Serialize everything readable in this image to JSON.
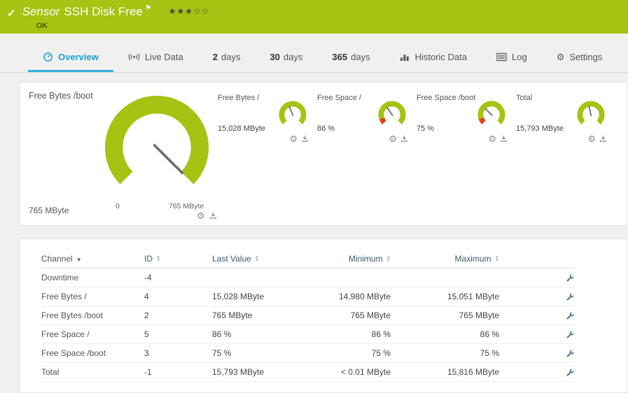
{
  "colors": {
    "brand_green": "#a5c312",
    "threshold_red": "#e0440f",
    "tab_blue": "#1d9ed3"
  },
  "header": {
    "title_prefix": "Sensor",
    "title": "SSH Disk Free",
    "status": "OK",
    "stars_filled": "★★★",
    "stars_empty": "☆☆"
  },
  "tabs": [
    {
      "label": "Overview"
    },
    {
      "label": "Live Data"
    },
    {
      "prefix": "2",
      "label": "days"
    },
    {
      "prefix": "30",
      "label": "days"
    },
    {
      "prefix": "365",
      "label": "days"
    },
    {
      "label": "Historic Data"
    },
    {
      "label": "Log"
    },
    {
      "label": "Settings"
    }
  ],
  "gauge_panel": {
    "primary": {
      "label": "Free Bytes /boot",
      "value": "765 MByte",
      "scale_min": "0",
      "scale_max": "765 MByte"
    },
    "minis": [
      {
        "label": "Free Bytes /",
        "value": "15,028 MByte"
      },
      {
        "label": "Free Space /",
        "value": "86 %"
      },
      {
        "label": "Free Space /boot",
        "value": "75 %"
      },
      {
        "label": "Total",
        "value": "15,793 MByte"
      }
    ]
  },
  "table": {
    "headers": [
      {
        "label": "Channel"
      },
      {
        "label": "ID"
      },
      {
        "label": "Last Value"
      },
      {
        "label": "Minimum"
      },
      {
        "label": "Maximum"
      }
    ],
    "rows": [
      {
        "channel": "Downtime",
        "id": "-4",
        "last_value": "",
        "minimum": "",
        "maximum": ""
      },
      {
        "channel": "Free Bytes /",
        "id": "4",
        "last_value": "15,028 MByte",
        "minimum": "14,980 MByte",
        "maximum": "15,051 MByte"
      },
      {
        "channel": "Free Bytes /boot",
        "id": "2",
        "last_value": "765 MByte",
        "minimum": "765 MByte",
        "maximum": "765 MByte"
      },
      {
        "channel": "Free Space /",
        "id": "5",
        "last_value": "86 %",
        "minimum": "86 %",
        "maximum": "86 %"
      },
      {
        "channel": "Free Space /boot",
        "id": "3",
        "last_value": "75 %",
        "minimum": "75 %",
        "maximum": "75 %"
      },
      {
        "channel": "Total",
        "id": "-1",
        "last_value": "15,793 MByte",
        "minimum": "< 0.01 MByte",
        "maximum": "15,816 MByte"
      }
    ]
  }
}
